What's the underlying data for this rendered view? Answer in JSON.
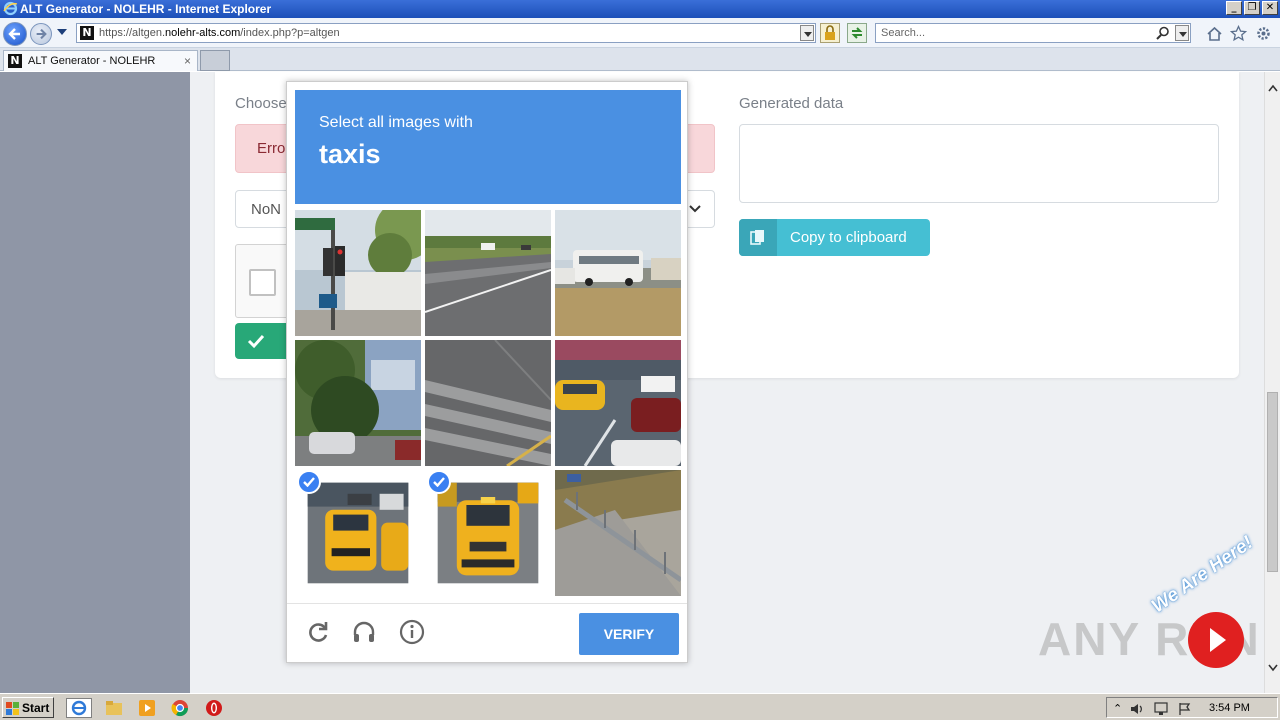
{
  "window": {
    "title": "ALT Generator - NOLEHR - Internet Explorer",
    "buttons": {
      "minimize": "_",
      "restore": "❐",
      "close": "✕"
    }
  },
  "nav": {
    "url_prefix": "https://altgen.",
    "url_domain": "nolehr-alts.com",
    "url_path": "/index.php?p=altgen",
    "search_placeholder": "Search..."
  },
  "tabs": [
    {
      "label": "ALT Generator - NOLEHR",
      "close": "×"
    }
  ],
  "page": {
    "choose_label": "Choose",
    "error_text": "Erro",
    "select_value": "NoN",
    "generated_label": "Generated data",
    "copy_button": "Copy to clipboard"
  },
  "captcha": {
    "instruction": "Select all images with",
    "target": "taxis",
    "verify_label": "VERIFY",
    "selected_tiles": [
      7,
      8
    ]
  },
  "watermark": {
    "brand": "ANY  RUN",
    "slogan": "We Are Here!"
  },
  "taskbar": {
    "start_label": "Start",
    "clock": "3:54 PM"
  }
}
